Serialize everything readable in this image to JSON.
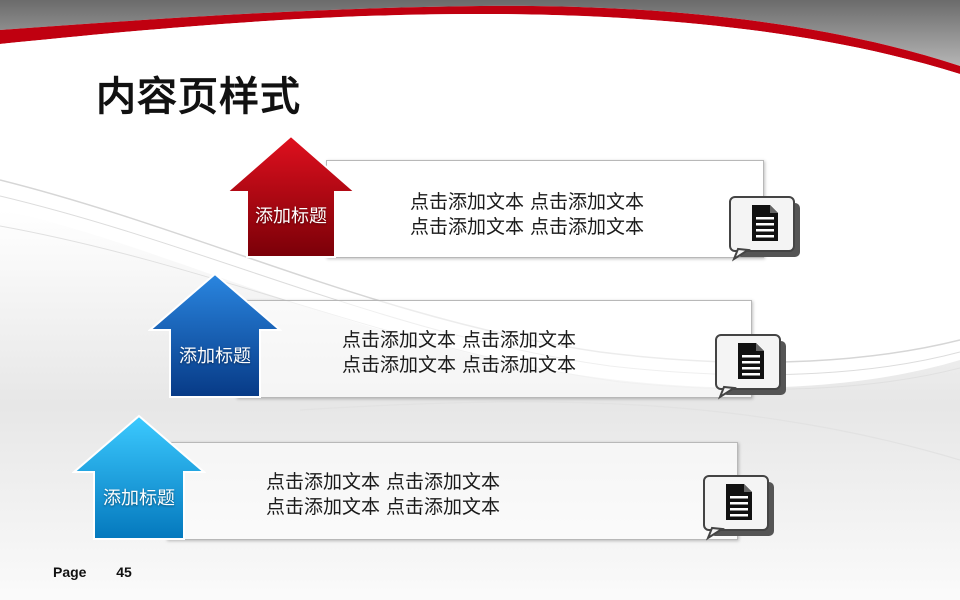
{
  "slide": {
    "title": "内容页样式",
    "footer": {
      "page_label": "Page",
      "page_number": "45"
    }
  },
  "rows": [
    {
      "heading": "添加标题",
      "line1": "点击添加文本 点击添加文本",
      "line2": "点击添加文本 点击添加文本",
      "color": "red",
      "icon": "document-icon"
    },
    {
      "heading": "添加标题",
      "line1": "点击添加文本 点击添加文本",
      "line2": "点击添加文本 点击添加文本",
      "color": "blue",
      "icon": "document-icon"
    },
    {
      "heading": "添加标题",
      "line1": "点击添加文本 点击添加文本",
      "line2": "点击添加文本 点击添加文本",
      "color": "cyan",
      "icon": "document-icon"
    }
  ],
  "colors": {
    "accent_red": "#c00010",
    "blue": "#0a55b8",
    "cyan": "#00a6e6"
  }
}
